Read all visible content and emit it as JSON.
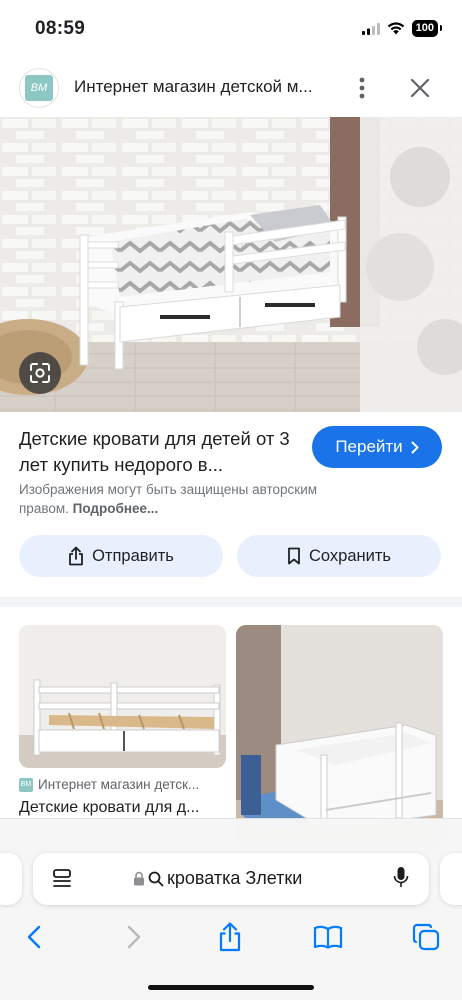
{
  "status": {
    "time": "08:59",
    "battery": "100"
  },
  "header": {
    "logo_text": "BM",
    "title": "Интернет магазин детской м..."
  },
  "result": {
    "title": "Детские кровати для детей от 3 лет купить недорого в...",
    "visit_label": "Перейти",
    "copyright_text": "Изображения могут быть защищены авторским правом.",
    "copyright_more": "Подробнее..."
  },
  "actions": {
    "share_label": "Отправить",
    "save_label": "Сохранить"
  },
  "related": {
    "items": [
      {
        "source": "Интернет магазин детск...",
        "title": "Детские кровати для д..."
      }
    ]
  },
  "browser": {
    "address": "кроватка Злетки"
  },
  "colors": {
    "accent": "#1a73e8",
    "chip_bg": "#e8f0fe",
    "logo": "#8cc7c3"
  },
  "icons": {
    "more": "more-vert-icon",
    "close": "close-icon",
    "lens": "lens-icon",
    "share": "share-icon",
    "save": "bookmark-icon"
  }
}
